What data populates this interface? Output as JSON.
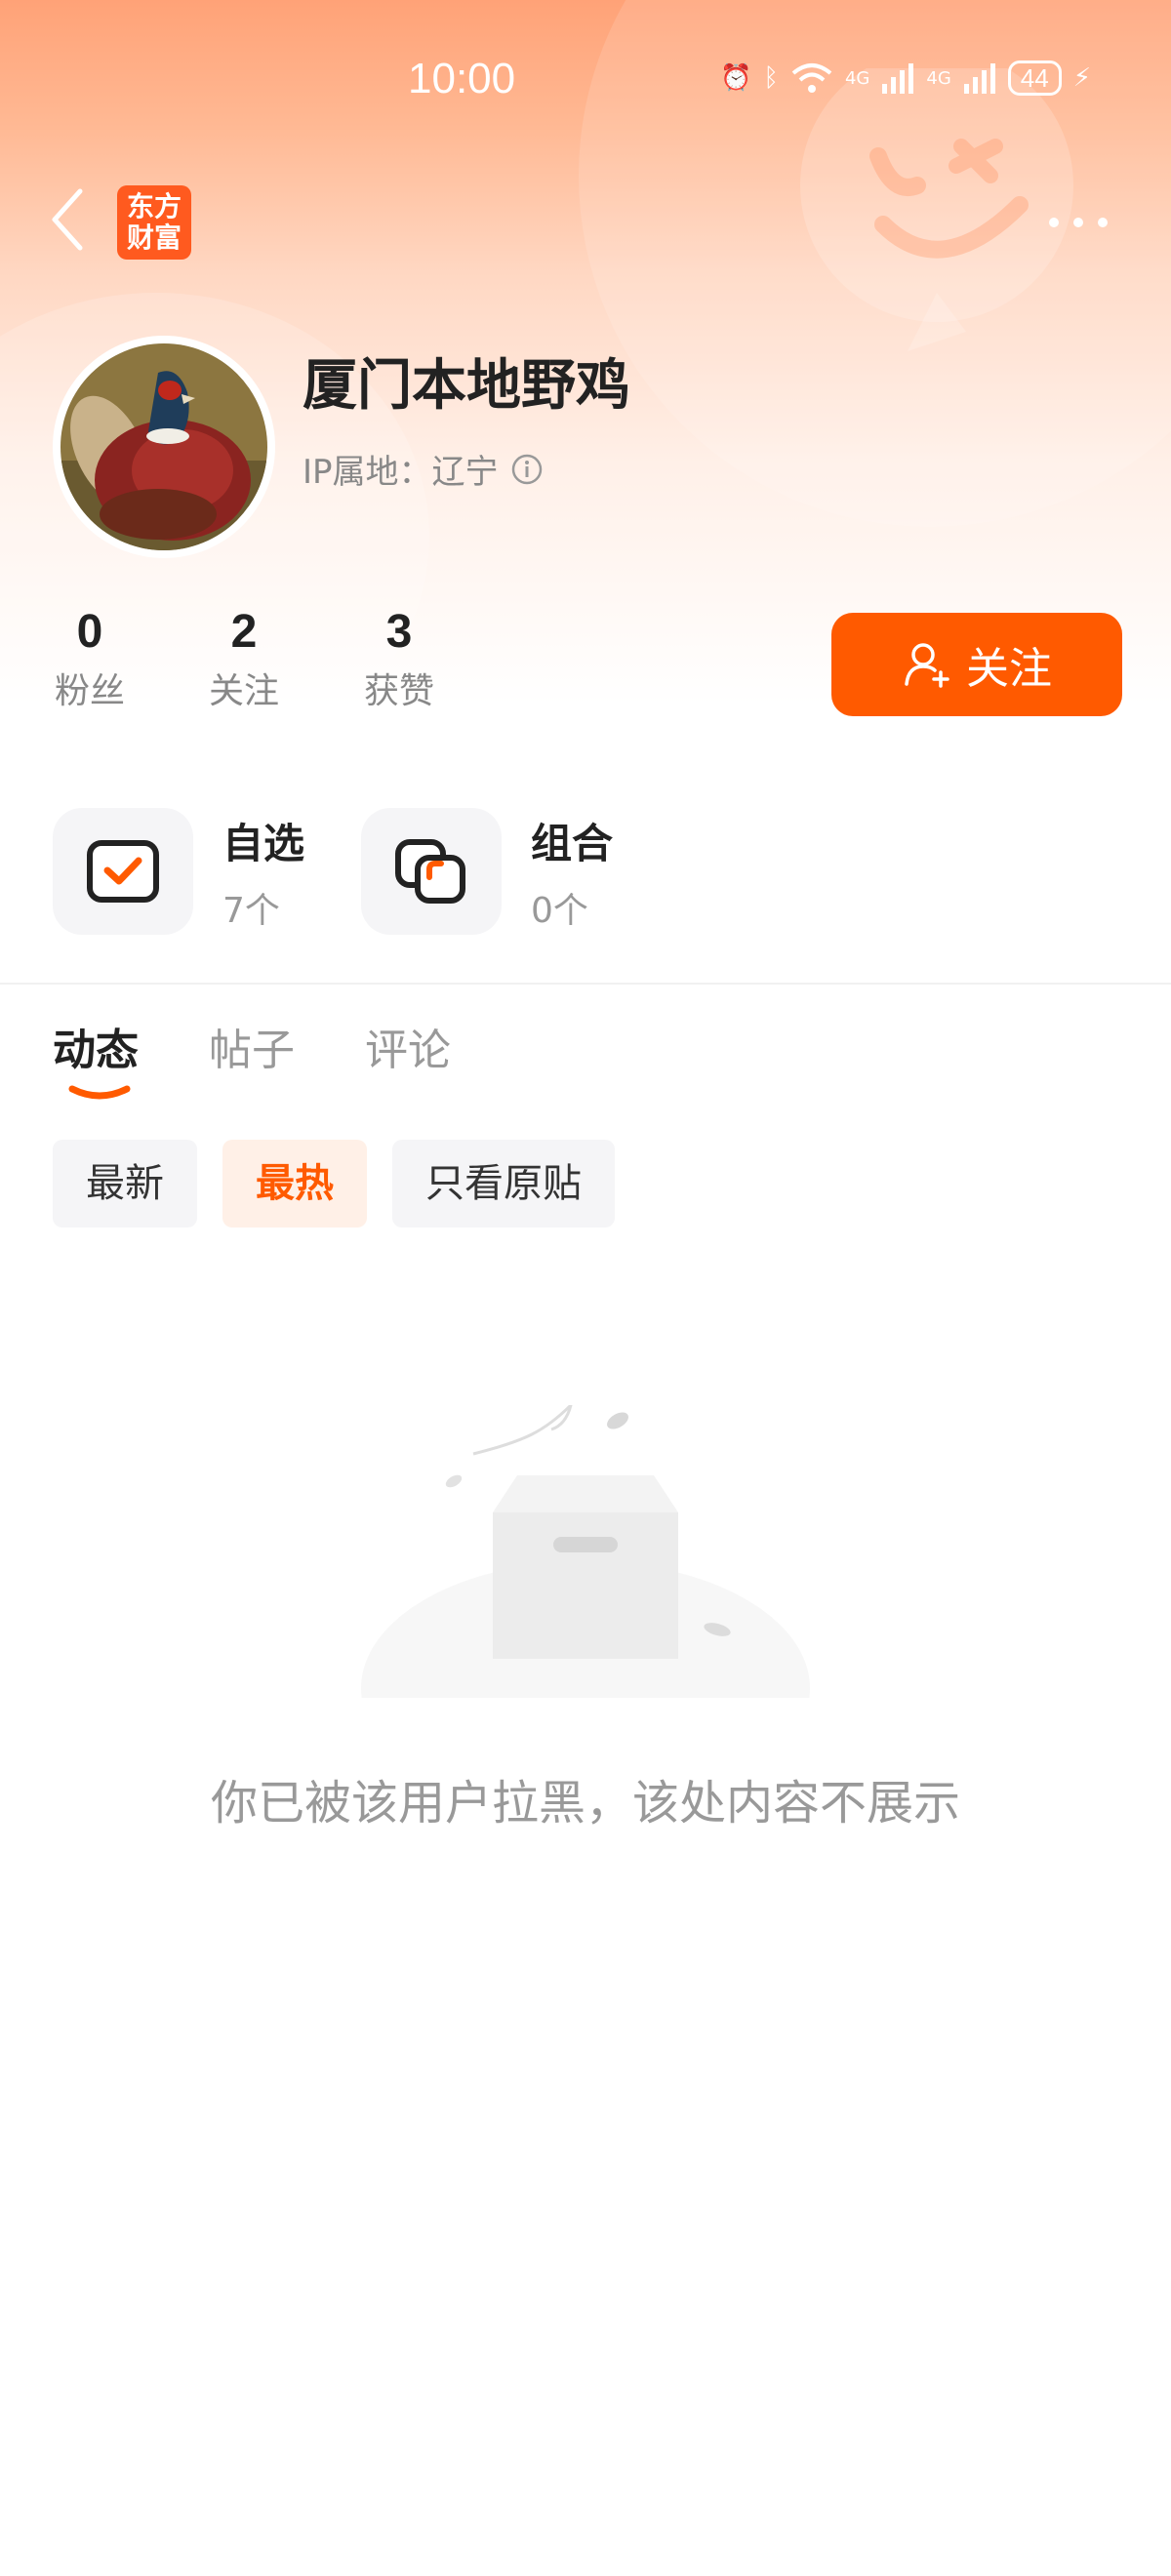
{
  "status_bar": {
    "time": "10:00",
    "network_a": "4G",
    "network_b": "4G",
    "battery": "44"
  },
  "header": {
    "logo_line1": "东方",
    "logo_line2": "财富"
  },
  "profile": {
    "name": "厦门本地野鸡",
    "ip_location": "IP属地：辽宁",
    "stats": [
      {
        "value": "0",
        "label": "粉丝"
      },
      {
        "value": "2",
        "label": "关注"
      },
      {
        "value": "3",
        "label": "获赞"
      }
    ],
    "follow_label": "关注"
  },
  "entries": [
    {
      "title": "自选",
      "count": "7个"
    },
    {
      "title": "组合",
      "count": "0个"
    }
  ],
  "tabs": [
    {
      "label": "动态",
      "active": true
    },
    {
      "label": "帖子",
      "active": false
    },
    {
      "label": "评论",
      "active": false
    }
  ],
  "filters": [
    {
      "label": "最新",
      "active": false
    },
    {
      "label": "最热",
      "active": true
    },
    {
      "label": "只看原贴",
      "active": false
    }
  ],
  "empty_message": "你已被该用户拉黑，该处内容不展示",
  "colors": {
    "accent": "#ff5a00",
    "brand": "#ff5a1f"
  }
}
